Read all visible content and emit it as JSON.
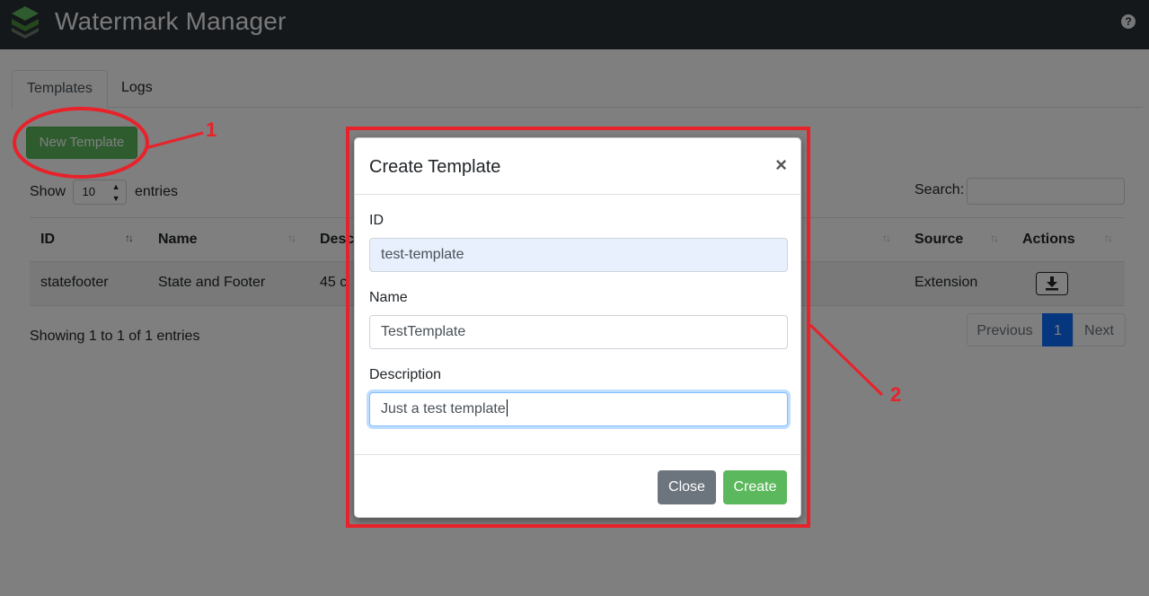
{
  "header": {
    "title": "Watermark Manager",
    "help_icon": "question-circle-icon",
    "help_glyph": "?"
  },
  "tabs": [
    {
      "label": "Templates",
      "active": true
    },
    {
      "label": "Logs",
      "active": false
    }
  ],
  "toolbar": {
    "new_template_label": "New Template"
  },
  "length": {
    "prefix": "Show",
    "value": "10",
    "suffix": "entries"
  },
  "search": {
    "label": "Search:",
    "value": ""
  },
  "table": {
    "columns": [
      "ID",
      "Name",
      "Desc",
      "Source",
      "Actions"
    ],
    "rows": [
      {
        "id": "statefooter",
        "name": "State and Footer",
        "desc": "45 c",
        "source": "Extension",
        "action_icon": "download-icon"
      }
    ]
  },
  "table_info": "Showing 1 to 1 of 1 entries",
  "pagination": {
    "previous": "Previous",
    "current": "1",
    "next": "Next"
  },
  "modal": {
    "title": "Create Template",
    "close_glyph": "×",
    "fields": [
      {
        "label": "ID",
        "value": "test-template"
      },
      {
        "label": "Name",
        "value": "TestTemplate"
      },
      {
        "label": "Description",
        "value": "Just a test template"
      }
    ],
    "close_label": "Close",
    "create_label": "Create"
  },
  "annotations": {
    "marker_1": "1",
    "marker_2": "2",
    "color": "#e8222a"
  },
  "colors": {
    "header_bg": "#2b3035",
    "success": "#5cb85c",
    "primary": "#0d6efd",
    "secondary": "#6c757d"
  }
}
